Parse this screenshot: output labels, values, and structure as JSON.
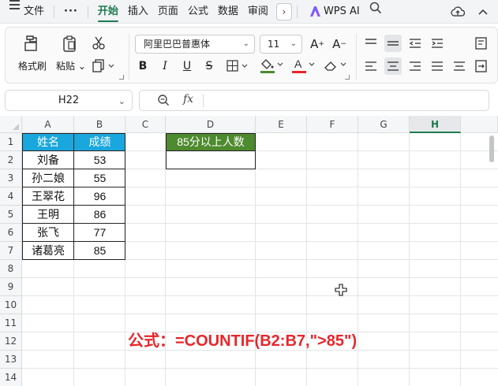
{
  "menubar": {
    "file": "文件",
    "more": "···",
    "tabs": [
      "开始",
      "插入",
      "页面",
      "公式",
      "数据",
      "审阅"
    ],
    "more_tabs": "›",
    "wps_ai": "WPS AI"
  },
  "ribbon": {
    "format_painter": "格式刷",
    "paste": "粘贴",
    "font_name": "阿里巴巴普惠体",
    "font_size": "11",
    "bold": "B",
    "italic": "I",
    "underline": "U",
    "strike": "S",
    "grow_font": "A",
    "shrink_font": "A"
  },
  "formula_bar": {
    "name_box": "H22",
    "fx": "fx",
    "content": ""
  },
  "sheet": {
    "columns": [
      "A",
      "B",
      "C",
      "D",
      "E",
      "F",
      "G",
      "H"
    ],
    "rows": [
      "1",
      "2",
      "3",
      "4",
      "5",
      "6",
      "7",
      "8",
      "9",
      "10",
      "11",
      "12",
      "13",
      "14"
    ],
    "selected_column": "H",
    "table": {
      "headers": [
        "姓名",
        "成绩"
      ],
      "rows": [
        [
          "刘备",
          "53"
        ],
        [
          "孙二娘",
          "55"
        ],
        [
          "王翠花",
          "96"
        ],
        [
          "王明",
          "86"
        ],
        [
          "张飞",
          "77"
        ],
        [
          "诸葛亮",
          "85"
        ]
      ]
    },
    "result_header": "85分以上人数",
    "result_value": ""
  },
  "annotation": "公式：=COUNTIF(B2:B7,\">85\")",
  "colors": {
    "accent": "#1f7a4f",
    "table_header": "#1aa7dd",
    "result_header": "#4e8a2e",
    "annotation": "#e8262a"
  }
}
